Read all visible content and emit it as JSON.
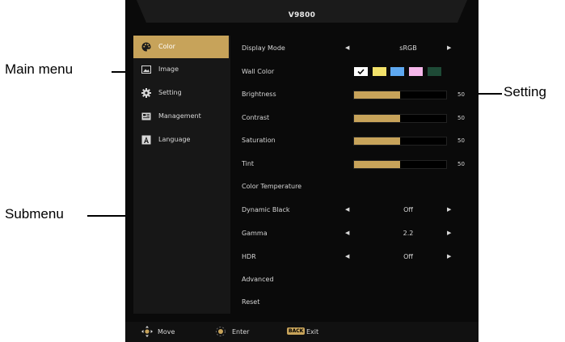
{
  "osd": {
    "title": "V9800"
  },
  "menu": [
    {
      "label": "Color",
      "icon": "palette-icon",
      "active": true
    },
    {
      "label": "Image",
      "icon": "image-icon",
      "active": false
    },
    {
      "label": "Setting",
      "icon": "gear-icon",
      "active": false
    },
    {
      "label": "Management",
      "icon": "management-icon",
      "active": false
    },
    {
      "label": "Language",
      "icon": "language-icon",
      "active": false
    }
  ],
  "submenu": {
    "display_mode": {
      "label": "Display Mode",
      "value": "sRGB"
    },
    "wall_color": {
      "label": "Wall Color",
      "swatches": [
        "#ffffff",
        "#f3e26b",
        "#5ea8f0",
        "#f5b7ea",
        "#1e4a36"
      ]
    },
    "brightness": {
      "label": "Brightness",
      "value": "50",
      "level": 0.5
    },
    "contrast": {
      "label": "Contrast",
      "value": "50",
      "level": 0.5
    },
    "saturation": {
      "label": "Saturation",
      "value": "50",
      "level": 0.5
    },
    "tint": {
      "label": "Tint",
      "value": "50",
      "level": 0.5
    },
    "color_temperature": {
      "label": "Color Temperature"
    },
    "dynamic_black": {
      "label": "Dynamic Black",
      "value": "Off"
    },
    "gamma": {
      "label": "Gamma",
      "value": "2.2"
    },
    "hdr": {
      "label": "HDR",
      "value": "Off"
    },
    "advanced": {
      "label": "Advanced"
    },
    "reset": {
      "label": "Reset"
    }
  },
  "footer": {
    "move": "Move",
    "enter": "Enter",
    "back_badge": "BACK",
    "exit": "Exit"
  },
  "annotations": {
    "main_menu": "Main menu",
    "setting": "Setting",
    "submenu": "Submenu"
  },
  "colors": {
    "accent": "#c7a35a",
    "panel": "#0a0a0a",
    "sidebar": "#171717"
  }
}
